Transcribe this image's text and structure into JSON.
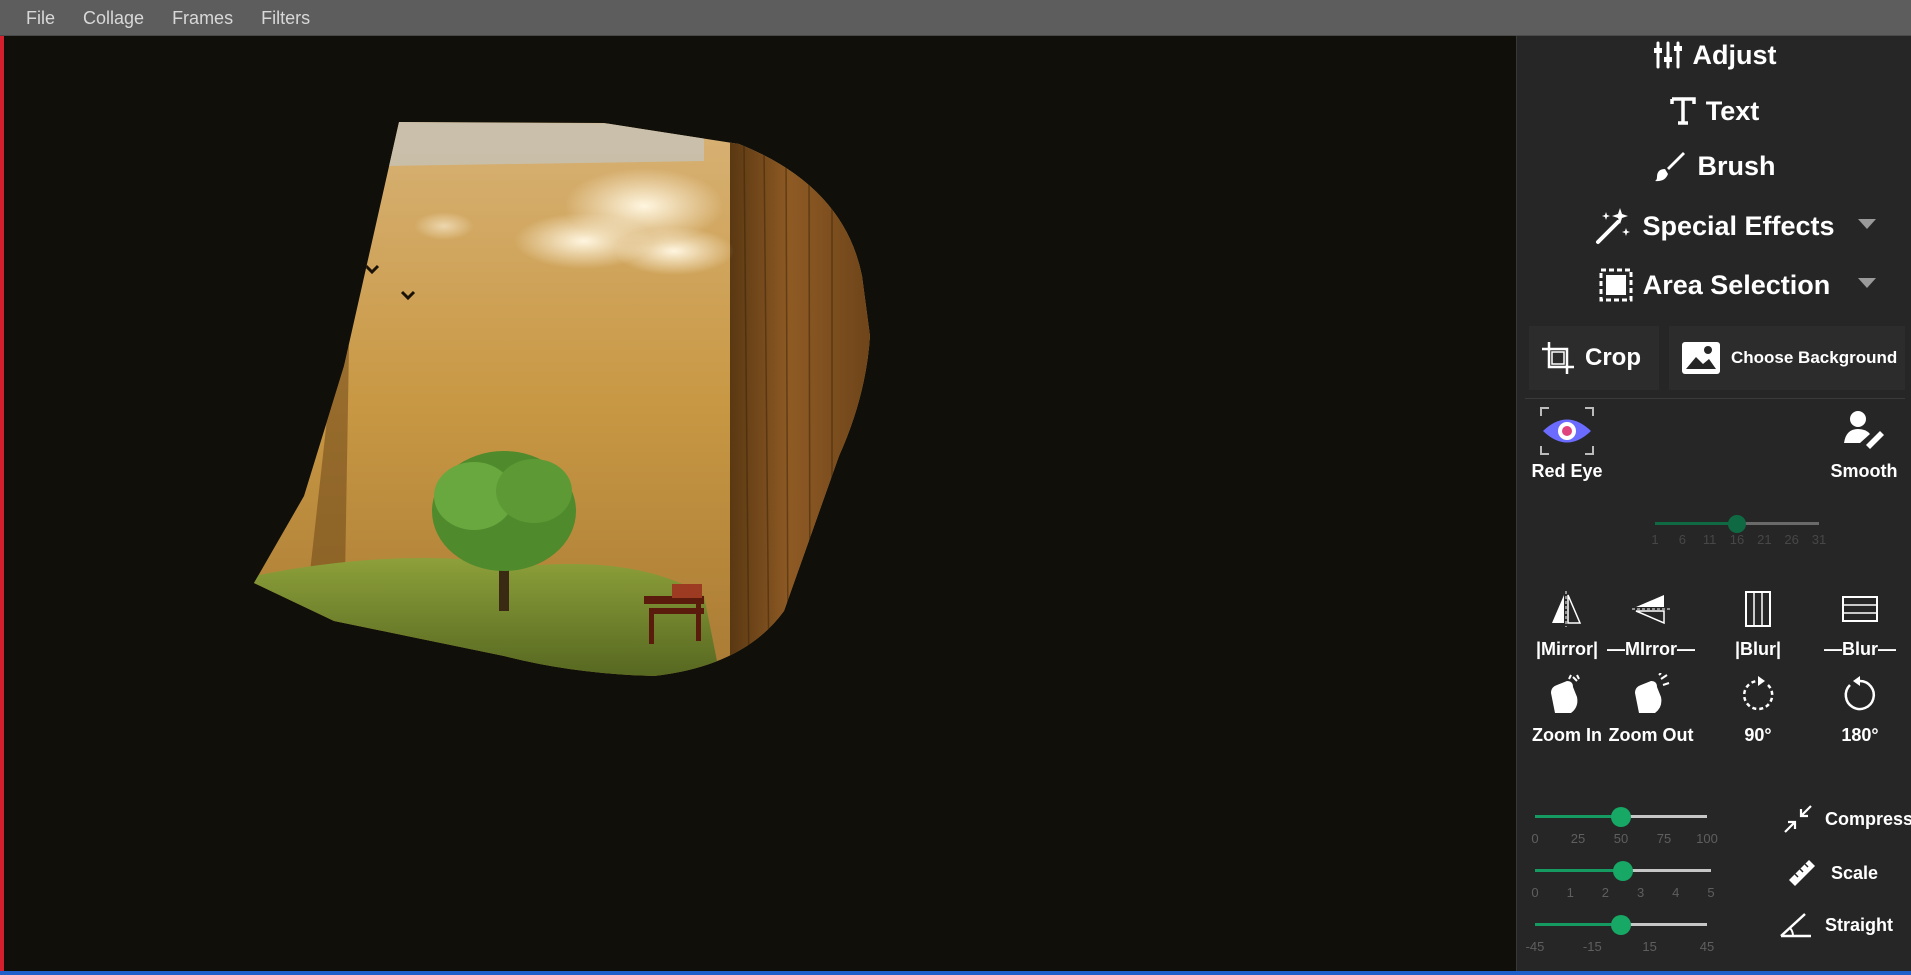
{
  "menu": [
    "File",
    "Collage",
    "Frames",
    "Filters"
  ],
  "panel": {
    "adjust": "Adjust",
    "text": "Text",
    "brush": "Brush",
    "special_effects": "Special Effects",
    "area_selection": "Area Selection",
    "crop": "Crop",
    "choose_background": "Choose Background",
    "red_eye": "Red Eye",
    "smooth": "Smooth",
    "smooth_slider": {
      "value": 16,
      "min": 1,
      "max": 31,
      "ticks": [
        "1",
        "6",
        "11",
        "16",
        "21",
        "26",
        "31"
      ]
    },
    "mirror_vertical": "|Mirror|",
    "mirror_horizontal": "—MIrror—",
    "blur_vertical": "|Blur|",
    "blur_horizontal": "—Blur—",
    "zoom_in": "Zoom In",
    "zoom_out": "Zoom Out",
    "rotate_90": "90°",
    "rotate_180": "180°",
    "compress": "Compress",
    "compress_slider": {
      "value": 50,
      "min": 0,
      "max": 100,
      "ticks": [
        "0",
        "25",
        "50",
        "75",
        "100"
      ]
    },
    "scale": "Scale",
    "scale_slider": {
      "value": 2.5,
      "min": 0,
      "max": 5,
      "ticks": [
        "0",
        "1",
        "2",
        "3",
        "4",
        "5"
      ]
    },
    "straight": "Straight",
    "straight_slider": {
      "value": 0,
      "min": -45,
      "max": 45,
      "ticks": [
        "-45",
        "-15",
        "15",
        "45"
      ]
    }
  },
  "colors": {
    "accent": "#16a864",
    "panel_bg": "#262626",
    "canvas_bg": "#100f0a",
    "menu_bg": "#5d5d5d",
    "red_eye": "#6b6bff"
  }
}
